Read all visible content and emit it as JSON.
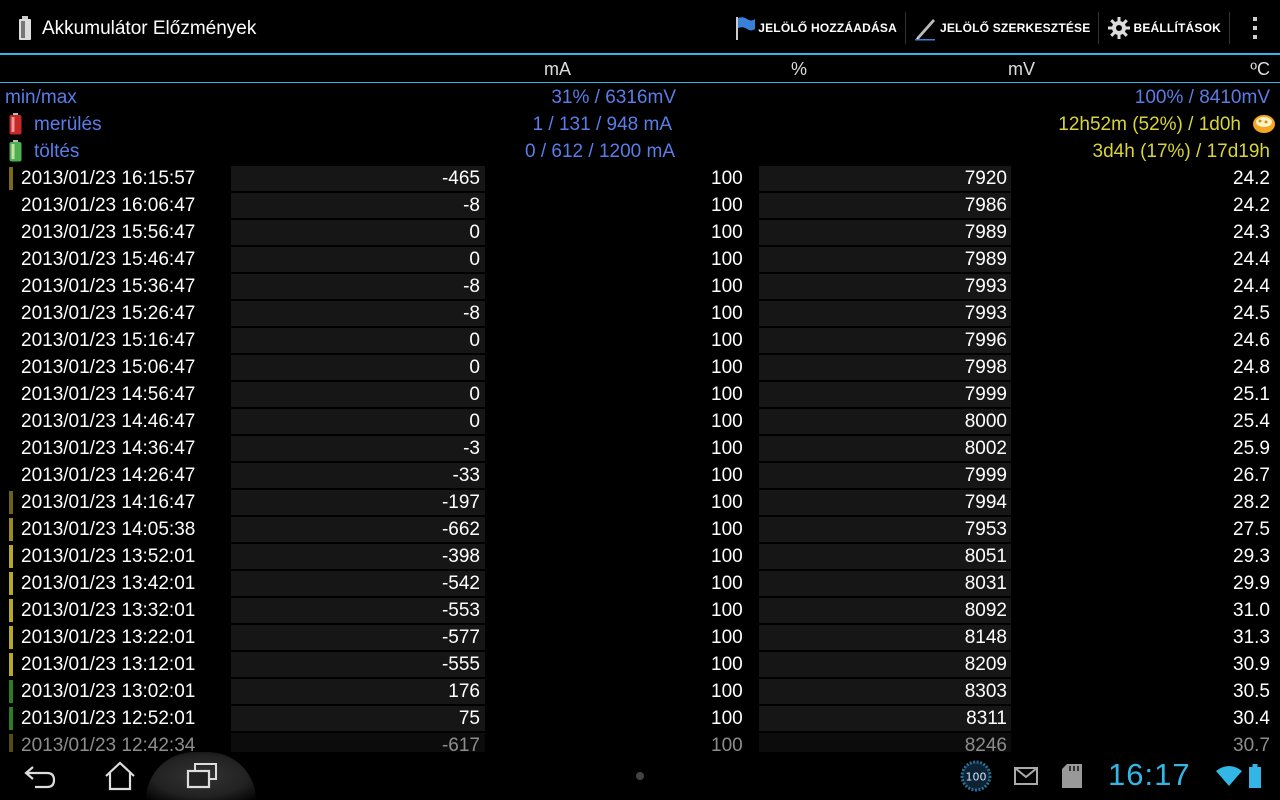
{
  "app": {
    "title": "Akkumulátor Előzmények"
  },
  "actions": [
    {
      "label": "JELÖLŐ HOZZÁADÁSA",
      "icon": "flag-icon"
    },
    {
      "label": "JELÖLŐ SZERKESZTÉSE",
      "icon": "pen-icon"
    },
    {
      "label": "BEÁLLÍTÁSOK",
      "icon": "gear-icon"
    }
  ],
  "columns": {
    "ma": "mA",
    "pct": "%",
    "mv": "mV",
    "temp": "ºC"
  },
  "summary": {
    "minmax_label": "min/max",
    "minmax_pct": "31% / 6316mV",
    "minmax_mv": "100% / 8410mV",
    "discharge_label": "merülés",
    "discharge_ma": "1 / 131 / 948 mA",
    "discharge_time": "12h52m (52%) / 1d0h",
    "charge_label": "töltés",
    "charge_ma": "0 / 612 / 1200 mA",
    "charge_time": "3d4h (17%) / 17d19h"
  },
  "rows": [
    {
      "datetime": "2013/01/23   16:15:57",
      "ma": "-465",
      "pct": "100",
      "mv": "7920",
      "temp": "24.2",
      "bar": "#7a6a1a"
    },
    {
      "datetime": "2013/01/23   16:06:47",
      "ma": "-8",
      "pct": "100",
      "mv": "7986",
      "temp": "24.2",
      "bar": ""
    },
    {
      "datetime": "2013/01/23   15:56:47",
      "ma": "0",
      "pct": "100",
      "mv": "7989",
      "temp": "24.3",
      "bar": ""
    },
    {
      "datetime": "2013/01/23   15:46:47",
      "ma": "0",
      "pct": "100",
      "mv": "7989",
      "temp": "24.4",
      "bar": ""
    },
    {
      "datetime": "2013/01/23   15:36:47",
      "ma": "-8",
      "pct": "100",
      "mv": "7993",
      "temp": "24.4",
      "bar": ""
    },
    {
      "datetime": "2013/01/23   15:26:47",
      "ma": "-8",
      "pct": "100",
      "mv": "7993",
      "temp": "24.5",
      "bar": ""
    },
    {
      "datetime": "2013/01/23   15:16:47",
      "ma": "0",
      "pct": "100",
      "mv": "7996",
      "temp": "24.6",
      "bar": ""
    },
    {
      "datetime": "2013/01/23   15:06:47",
      "ma": "0",
      "pct": "100",
      "mv": "7998",
      "temp": "24.8",
      "bar": ""
    },
    {
      "datetime": "2013/01/23   14:56:47",
      "ma": "0",
      "pct": "100",
      "mv": "7999",
      "temp": "25.1",
      "bar": ""
    },
    {
      "datetime": "2013/01/23   14:46:47",
      "ma": "0",
      "pct": "100",
      "mv": "8000",
      "temp": "25.4",
      "bar": ""
    },
    {
      "datetime": "2013/01/23   14:36:47",
      "ma": "-3",
      "pct": "100",
      "mv": "8002",
      "temp": "25.9",
      "bar": ""
    },
    {
      "datetime": "2013/01/23   14:26:47",
      "ma": "-33",
      "pct": "100",
      "mv": "7999",
      "temp": "26.7",
      "bar": ""
    },
    {
      "datetime": "2013/01/23   14:16:47",
      "ma": "-197",
      "pct": "100",
      "mv": "7994",
      "temp": "28.2",
      "bar": "#6b6118"
    },
    {
      "datetime": "2013/01/23   14:05:38",
      "ma": "-662",
      "pct": "100",
      "mv": "7953",
      "temp": "27.5",
      "bar": "#9a8a20"
    },
    {
      "datetime": "2013/01/23   13:52:01",
      "ma": "-398",
      "pct": "100",
      "mv": "8051",
      "temp": "29.3",
      "bar": "#b8a828"
    },
    {
      "datetime": "2013/01/23   13:42:01",
      "ma": "-542",
      "pct": "100",
      "mv": "8031",
      "temp": "29.9",
      "bar": "#b8a828"
    },
    {
      "datetime": "2013/01/23   13:32:01",
      "ma": "-553",
      "pct": "100",
      "mv": "8092",
      "temp": "31.0",
      "bar": "#b8a828"
    },
    {
      "datetime": "2013/01/23   13:22:01",
      "ma": "-577",
      "pct": "100",
      "mv": "8148",
      "temp": "31.3",
      "bar": "#b8a828"
    },
    {
      "datetime": "2013/01/23   13:12:01",
      "ma": "-555",
      "pct": "100",
      "mv": "8209",
      "temp": "30.9",
      "bar": "#b8a828"
    },
    {
      "datetime": "2013/01/23   13:02:01",
      "ma": "176",
      "pct": "100",
      "mv": "8303",
      "temp": "30.5",
      "bar": "#2e7d22"
    },
    {
      "datetime": "2013/01/23   12:52:01",
      "ma": "75",
      "pct": "100",
      "mv": "8311",
      "temp": "30.4",
      "bar": "#2e7d22"
    },
    {
      "datetime": "2013/01/23   12:42:34",
      "ma": "-617",
      "pct": "100",
      "mv": "8246",
      "temp": "30.7",
      "bar": "#9a8a20"
    }
  ],
  "status": {
    "clock": "16:17",
    "battery_badge": "100"
  },
  "colors": {
    "accent": "#33b5e5",
    "summary_blue": "#5a7de8",
    "summary_yellow": "#d8d43a"
  }
}
